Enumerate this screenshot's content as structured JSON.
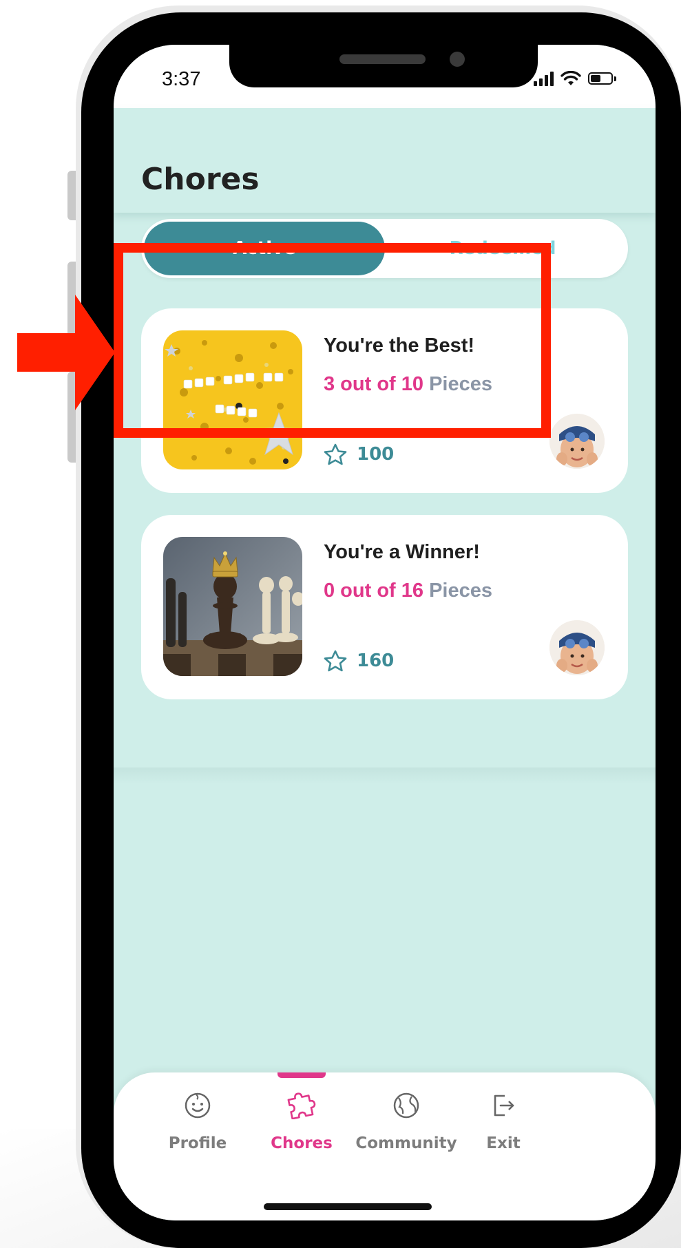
{
  "status_bar": {
    "time": "3:37"
  },
  "header": {
    "title": "Chores"
  },
  "tabs": [
    {
      "label": "Active",
      "selected": true
    },
    {
      "label": "Redeemed",
      "selected": false
    }
  ],
  "chores": [
    {
      "title": "You're the Best!",
      "progress_count": "3 out of 10",
      "progress_unit": " Pieces",
      "points": "100",
      "thumbnail": "yellow-confetti-image",
      "avatar": "child-avatar"
    },
    {
      "title": "You're a Winner!",
      "progress_count": "0 out of 16",
      "progress_unit": " Pieces",
      "points": "160",
      "thumbnail": "chess-pawn-crown-image",
      "avatar": "child-avatar"
    }
  ],
  "nav": [
    {
      "label": "Profile",
      "icon": "smiley-face-icon"
    },
    {
      "label": "Chores",
      "icon": "puzzle-piece-icon",
      "selected": true
    },
    {
      "label": "Community",
      "icon": "globe-icon"
    },
    {
      "label": "Exit",
      "icon": "exit-door-icon"
    }
  ],
  "colors": {
    "screen_bg": "#cfeee9",
    "active_tab": "#3d8b96",
    "inactive_tab_text": "#7fd3dc",
    "accent_pink": "#e0378a",
    "highlight_red": "#ff1f00"
  }
}
